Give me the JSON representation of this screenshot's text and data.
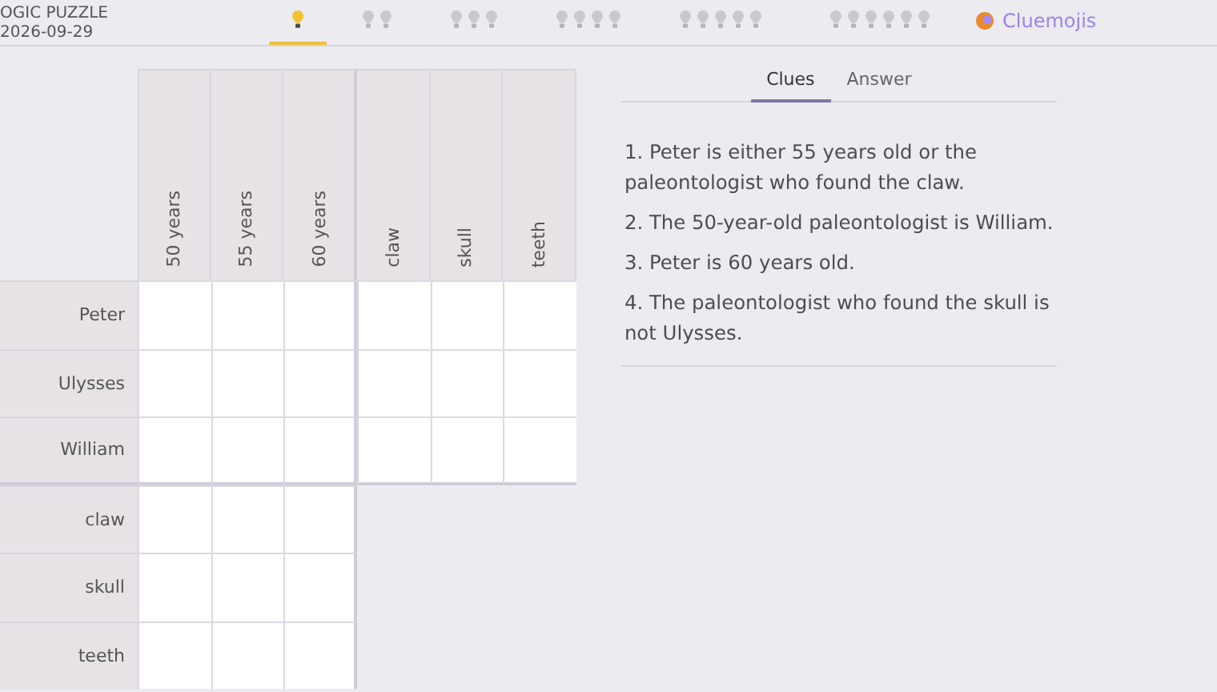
{
  "header": {
    "title": "OGIC PUZZLE",
    "date": "2026-09-29"
  },
  "difficulty_tabs": [
    {
      "selected": true,
      "bulbs": [
        {
          "lit": true
        }
      ]
    },
    {
      "selected": false,
      "bulbs": [
        {
          "lit": false
        },
        {
          "lit": false
        }
      ]
    },
    {
      "selected": false,
      "bulbs": [
        {
          "lit": false
        },
        {
          "lit": false
        },
        {
          "lit": false
        }
      ]
    },
    {
      "selected": false,
      "bulbs": [
        {
          "lit": false
        },
        {
          "lit": false
        },
        {
          "lit": false
        },
        {
          "lit": false
        }
      ]
    },
    {
      "selected": false,
      "bulbs": [
        {
          "lit": false
        },
        {
          "lit": false
        },
        {
          "lit": false
        },
        {
          "lit": false
        },
        {
          "lit": false
        }
      ]
    },
    {
      "selected": false,
      "bulbs": [
        {
          "lit": false
        },
        {
          "lit": false
        },
        {
          "lit": false
        },
        {
          "lit": false
        },
        {
          "lit": false
        },
        {
          "lit": false
        }
      ]
    }
  ],
  "brand_link": "Cluemojis",
  "grid": {
    "column_groups": [
      [
        "50 years",
        "55 years",
        "60 years"
      ],
      [
        "claw",
        "skull",
        "teeth"
      ]
    ],
    "row_groups": [
      [
        "Peter",
        "Ulysses",
        "William"
      ],
      [
        "claw",
        "skull",
        "teeth"
      ]
    ]
  },
  "panel_tabs": [
    {
      "label": "Clues",
      "selected": true
    },
    {
      "label": "Answer",
      "selected": false
    }
  ],
  "clues": [
    "1. Peter is either 55 years old or the paleontologist who found the claw.",
    "2. The 50-year-old paleontologist is William.",
    "3. Peter is 60 years old.",
    "4. The paleontologist who found the skull is not Ulysses."
  ]
}
